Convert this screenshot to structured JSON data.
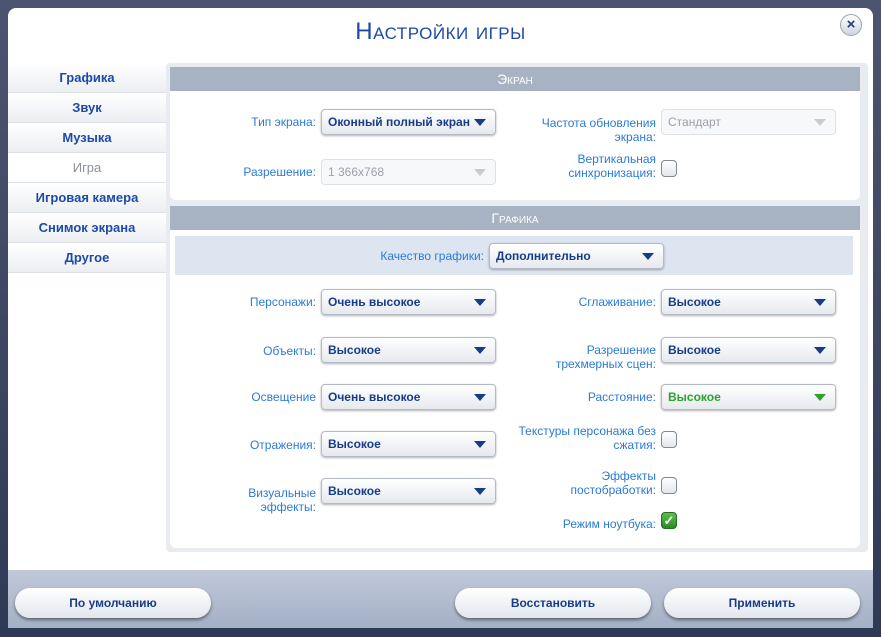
{
  "title": "Настройки игры",
  "close_icon": "×",
  "sidebar": [
    {
      "label": "Графика"
    },
    {
      "label": "Звук"
    },
    {
      "label": "Музыка"
    },
    {
      "label": "Игра"
    },
    {
      "label": "Игровая камера"
    },
    {
      "label": "Снимок экрана"
    },
    {
      "label": "Другое"
    }
  ],
  "screen": {
    "header": "Экран",
    "screen_type_label": "Тип экрана:",
    "screen_type_value": "Оконный полный экран",
    "refresh_label": "Частота обновления экрана:",
    "refresh_value": "Стандарт",
    "resolution_label": "Разрешение:",
    "resolution_value": "1 366x768",
    "vsync_label": "Вертикальная синхронизация:",
    "vsync_checked": false
  },
  "graphics": {
    "header": "Графика",
    "quality_label": "Качество графики:",
    "quality_value": "Дополнительно",
    "sims_label": "Персонажи:",
    "sims_value": "Очень высокое",
    "objects_label": "Объекты:",
    "objects_value": "Высокое",
    "lighting_label": "Освещение",
    "lighting_value": "Очень высокое",
    "reflections_label": "Отражения:",
    "reflections_value": "Высокое",
    "visual_label": "Визуальные эффекты:",
    "visual_value": "Высокое",
    "aa_label": "Сглаживание:",
    "aa_value": "Высокое",
    "3d_label": "Разрешение трехмерных сцен:",
    "3d_value": "Высокое",
    "distance_label": "Расстояние:",
    "distance_value": "Высокое",
    "textures_label": "Текстуры персонажа без сжатия:",
    "textures_checked": false,
    "post_label": "Эффекты постобработки:",
    "post_checked": false,
    "laptop_label": "Режим ноутбука:",
    "laptop_checked": true,
    "check_icon": "✓"
  },
  "buttons": {
    "defaults": "По умолчанию",
    "restore": "Восстановить",
    "apply": "Применить"
  },
  "colors": {
    "accent": "#1d4aa8",
    "label": "#2a7ad8",
    "green": "#2ea12e"
  }
}
